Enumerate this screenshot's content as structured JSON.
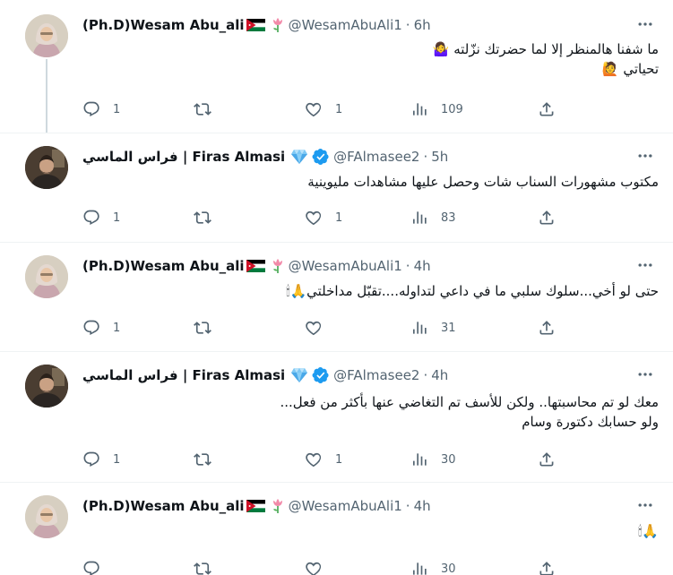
{
  "tweets": [
    {
      "author": "(Ph.D)Wesam Abu_ali",
      "handle": "@WesamAbuAli1",
      "time": "6h",
      "emoji": "🌷",
      "lines": [
        "ما شفنا هالمنظر إلا لما حضرتك نزّلته 🤷‍♀️",
        "تحياتي 🙋"
      ],
      "replies": "1",
      "retweets": "",
      "likes": "1",
      "views": "109"
    },
    {
      "author": "فراس الماسي | Firas Almasi",
      "handle": "@FAlmasee2",
      "time": "5h",
      "emoji": "💎",
      "lines": [
        "مكتوب مشهورات السناب شات وحصل عليها مشاهدات مليوينية"
      ],
      "replies": "1",
      "retweets": "",
      "likes": "1",
      "views": "83"
    },
    {
      "author": "(Ph.D)Wesam Abu_ali",
      "handle": "@WesamAbuAli1",
      "time": "4h",
      "emoji": "🌷",
      "lines": [
        "حتى لو أخي...سلوك سلبي ما في داعي لتداوله....تقبّل مداخلتي🙏🕯"
      ],
      "replies": "1",
      "retweets": "",
      "likes": "",
      "views": "31"
    },
    {
      "author": "فراس الماسي | Firas Almasi",
      "handle": "@FAlmasee2",
      "time": "4h",
      "emoji": "💎",
      "lines": [
        "معك لو تم محاسبتها.. ولكن للأسف تم التغاضي عنها بأكثر من فعل...",
        "ولو حسابك دكتورة وسام"
      ],
      "replies": "1",
      "retweets": "",
      "likes": "1",
      "views": "30"
    },
    {
      "author": "(Ph.D)Wesam Abu_ali",
      "handle": "@WesamAbuAli1",
      "time": "4h",
      "emoji": "🌷",
      "lines": [
        "🙏🕯"
      ],
      "replies": "",
      "retweets": "",
      "likes": "",
      "views": "30"
    }
  ],
  "colors": {
    "text": "#0f1419",
    "secondary": "#536471",
    "verified": "#1d9bf0",
    "divider": "#eff3f4",
    "thread_line": "#cfd9de"
  },
  "icons": [
    "more-icon",
    "reply-icon",
    "retweet-icon",
    "like-icon",
    "views-icon",
    "share-icon",
    "verified-badge-icon",
    "jordan-flag-icon",
    "tulip-icon",
    "gem-icon"
  ]
}
